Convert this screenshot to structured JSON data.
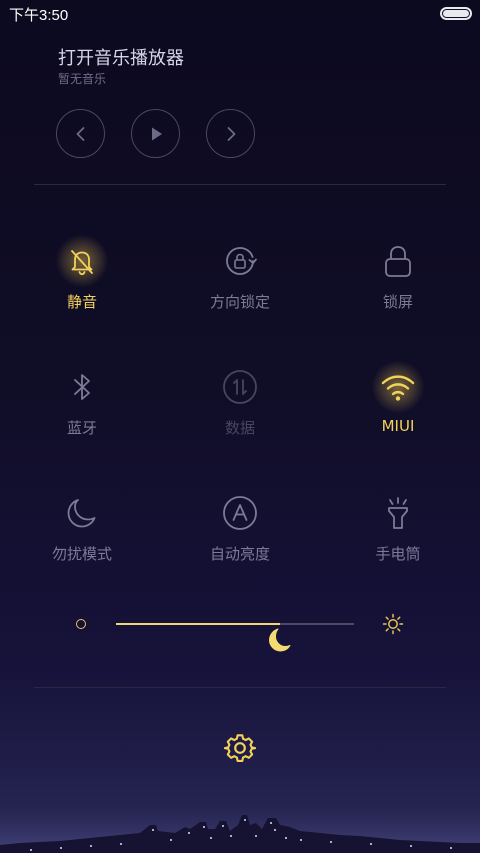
{
  "status_bar": {
    "time": "下午3:50",
    "battery_level": 1.0
  },
  "music": {
    "title": "打开音乐播放器",
    "subtitle": "暂无音乐",
    "controls": [
      "previous-icon",
      "play-icon",
      "next-icon"
    ]
  },
  "toggles": [
    {
      "label": "静音",
      "icon": "bell-off-icon",
      "state": "on"
    },
    {
      "label": "方向锁定",
      "icon": "rotation-lock-icon",
      "state": "off"
    },
    {
      "label": "锁屏",
      "icon": "lock-icon",
      "state": "off"
    },
    {
      "label": "蓝牙",
      "icon": "bluetooth-icon",
      "state": "off"
    },
    {
      "label": "数据",
      "icon": "mobile-data-icon",
      "state": "disabled"
    },
    {
      "label": "MIUI",
      "icon": "wifi-icon",
      "state": "on"
    },
    {
      "label": "勿扰模式",
      "icon": "moon-icon",
      "state": "off"
    },
    {
      "label": "自动亮度",
      "icon": "auto-brightness-icon",
      "state": "off"
    },
    {
      "label": "手电筒",
      "icon": "flashlight-icon",
      "state": "off"
    }
  ],
  "brightness": {
    "level": 0.69
  },
  "colors": {
    "active": "#f2d258",
    "inactive": "#7d7a98",
    "disabled": "#48465e",
    "background": "#0c0a1f"
  }
}
